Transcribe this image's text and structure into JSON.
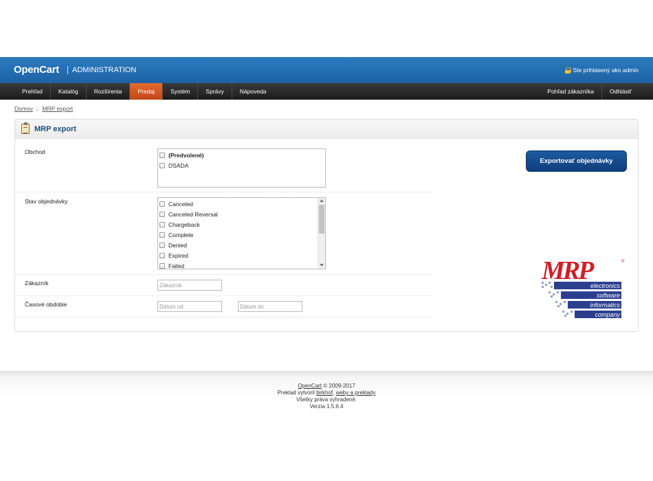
{
  "header": {
    "logo": "OpenCart",
    "admin": "ADMINISTRATION",
    "logged_in": "Ste prihlásený ako admin",
    "colors": {
      "header_top": "#2c7bbf",
      "header_bottom": "#1d62a3",
      "active_menu": "#e56b2a",
      "title": "#1e4d80",
      "button": "#1d5aa0"
    }
  },
  "menu": {
    "left": [
      "Prehľad",
      "Katalóg",
      "Rozšírenia",
      "Predaj",
      "Systém",
      "Správy",
      "Nápoveda"
    ],
    "active": "Predaj",
    "right": [
      "Pohľad zákazníka",
      "Odhlásiť"
    ]
  },
  "breadcrumb": {
    "home": "Domov",
    "separator": "::",
    "current": "MRP export"
  },
  "page": {
    "title": "MRP export",
    "export_button": "Exportovať objednávky",
    "store": {
      "label": "Obchod",
      "options": [
        "(Predvolené)",
        "DSADA"
      ]
    },
    "order_status": {
      "label": "Stav objednávky",
      "options": [
        "Canceled",
        "Canceled Reversal",
        "Chargeback",
        "Complete",
        "Denied",
        "Expired",
        "Failed"
      ]
    },
    "customer": {
      "label": "Zákazník",
      "placeholder": "Zákazník"
    },
    "period": {
      "label": "Časové obdobie",
      "from_placeholder": "Dátum od",
      "to_placeholder": "Dátum do"
    }
  },
  "mrp_logo": {
    "letters": "MRP",
    "registered": "®",
    "lines": [
      "electronics",
      "software",
      "informatics",
      "company"
    ]
  },
  "footer": {
    "brand_link": "OpenCart",
    "copyright": "© 2009-2017",
    "translation_prefix": "Preklad vytvoril",
    "translator_link": "birkhof",
    "translator_link2": "weby a preklady",
    "rights": "Všetky práva vyhradené.",
    "version": "Verzia 1.5.6.4"
  }
}
